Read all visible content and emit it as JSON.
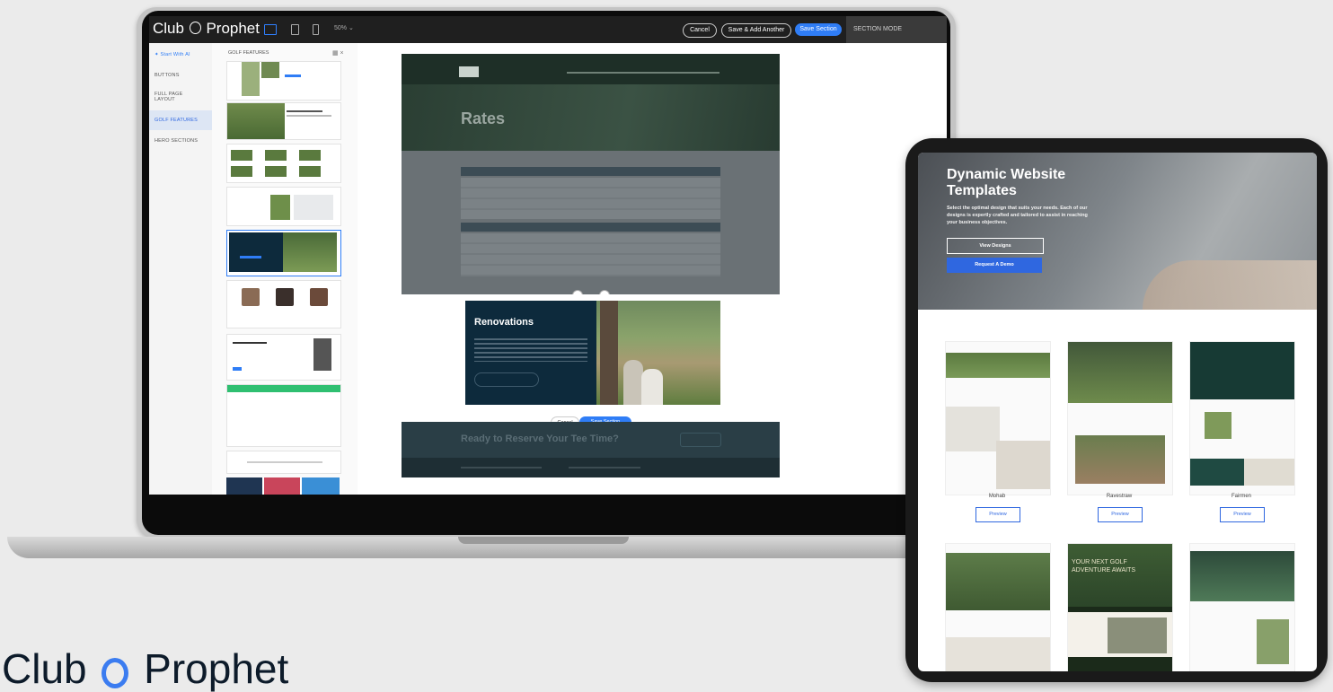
{
  "editor": {
    "brand": "Club",
    "brand2": "Prophet",
    "zoom": "50%  ⌄",
    "cancel": "Cancel",
    "save_add": "Save & Add Another",
    "save_section": "Save Section",
    "mode": "SECTION MODE"
  },
  "sidebar": {
    "start_ai": "Start With AI",
    "items": [
      "BUTTONS",
      "FULL PAGE LAYOUT",
      "GOLF FEATURES",
      "HERO SECTIONS"
    ]
  },
  "catpanel": {
    "title": "GOLF FEATURES"
  },
  "canvas": {
    "rates_title": "Rates",
    "renovations_title": "Renovations",
    "cancel": "Cancel",
    "save": "Save Section",
    "cta": "Ready to Reserve Your Tee Time?"
  },
  "tablet": {
    "hero_title": "Dynamic Website Templates",
    "hero_text": "Select the optimal design that suits your needs. Each of our designs is expertly crafted and tailored to assist in reaching your business objectives.",
    "view_designs": "View Designs",
    "request_demo": "Request A Demo",
    "templates": [
      {
        "name": "Mohab",
        "button": "Preview"
      },
      {
        "name": "Ravestraw",
        "button": "Preview"
      },
      {
        "name": "Fairmen",
        "button": "Preview"
      }
    ],
    "second_row_text": "YOUR NEXT GOLF ADVENTURE AWAITS"
  },
  "logo": {
    "part1": "Club",
    "part2": "Prophet"
  },
  "colors": {
    "accent": "#2f7df6",
    "dark": "#1f1f1f",
    "navy": "#0d2a3c"
  }
}
